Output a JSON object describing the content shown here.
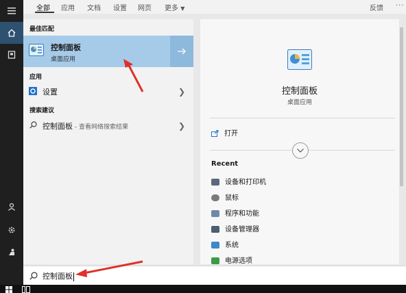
{
  "tabs": {
    "items": [
      {
        "label": "全部"
      },
      {
        "label": "应用"
      },
      {
        "label": "文档"
      },
      {
        "label": "设置"
      },
      {
        "label": "网页"
      },
      {
        "label": "更多"
      }
    ],
    "feedback": "反馈",
    "more_icon": "ellipsis-icon"
  },
  "results": {
    "best_match_header": "最佳匹配",
    "best": {
      "title": "控制面板",
      "subtitle": "桌面应用"
    },
    "apps_header": "应用",
    "apps": [
      {
        "label": "设置"
      }
    ],
    "suggest_header": "搜索建议",
    "suggestions": [
      {
        "label": "控制面板",
        "suffix": " - 查看网络搜索结果"
      }
    ]
  },
  "preview": {
    "title": "控制面板",
    "subtitle": "桌面应用",
    "open_label": "打开",
    "recent_header": "Recent",
    "recent": [
      {
        "label": "设备和打印机",
        "icon_color": "#5a6a7a"
      },
      {
        "label": "鼠标",
        "icon_color": "#7a7a7a"
      },
      {
        "label": "程序和功能",
        "icon_color": "#6f8aa6"
      },
      {
        "label": "设备管理器",
        "icon_color": "#4d5e70"
      },
      {
        "label": "系统",
        "icon_color": "#3c88c8"
      },
      {
        "label": "电源选项",
        "icon_color": "#3a9a48"
      }
    ]
  },
  "search": {
    "value": "控制面板"
  },
  "colors": {
    "accent": "#a6cbe9",
    "annotation": "#e0302a"
  }
}
